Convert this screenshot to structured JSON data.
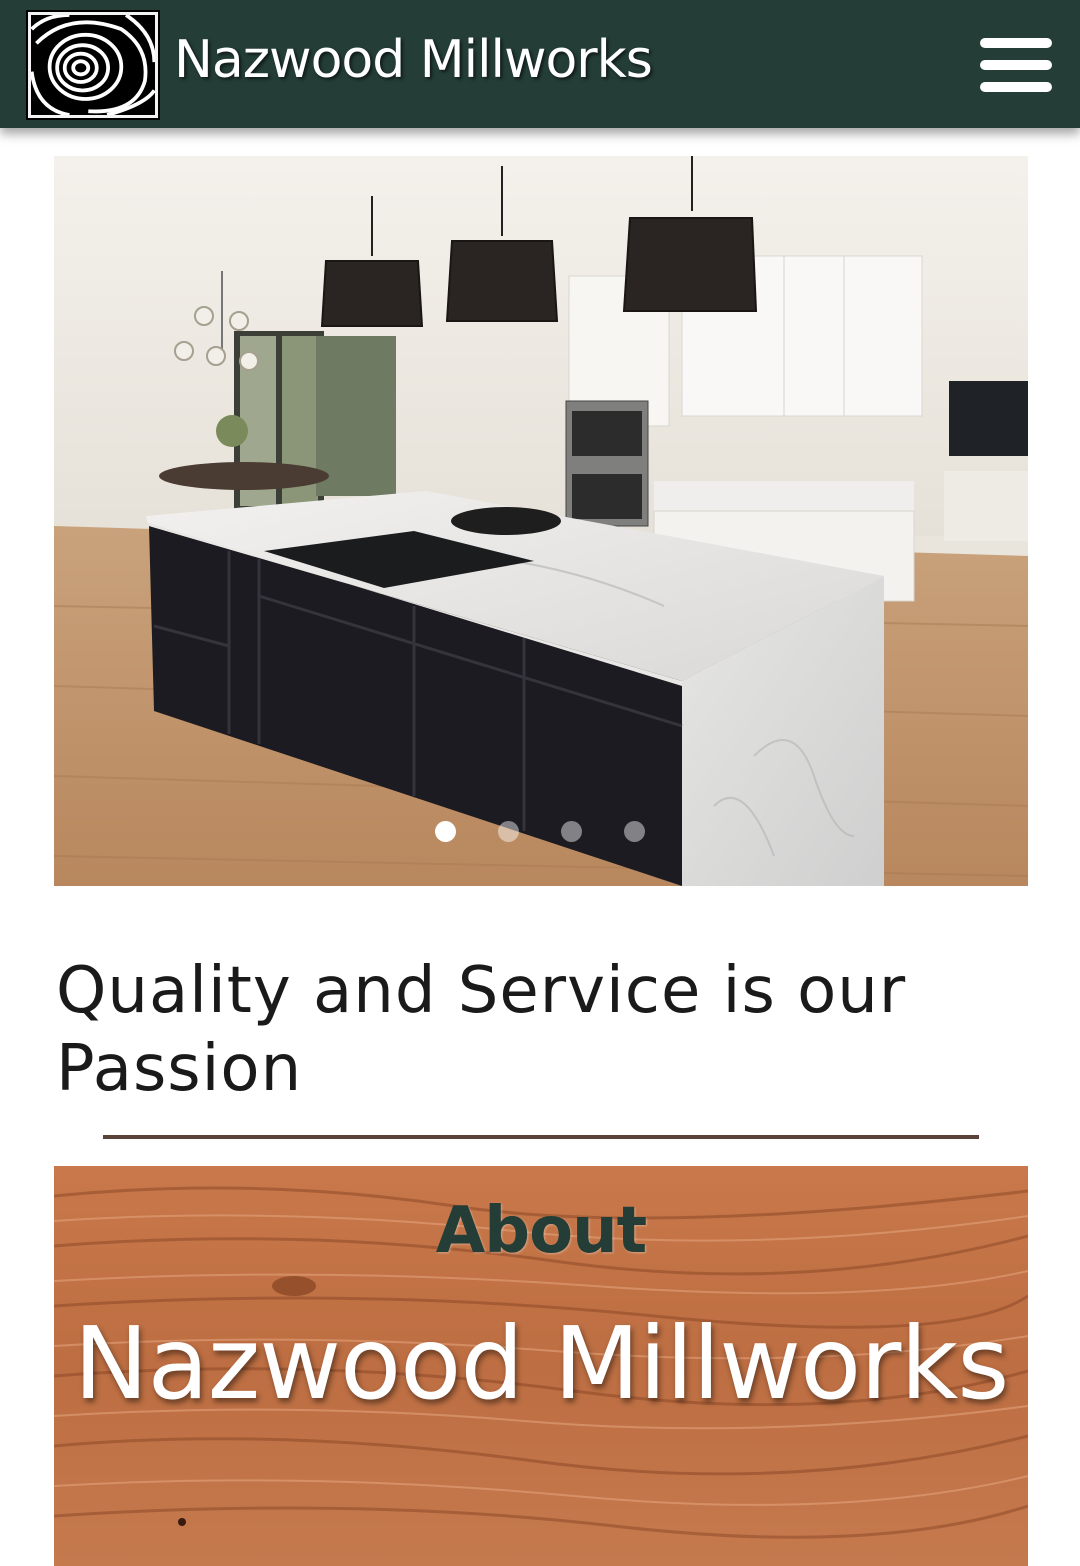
{
  "header": {
    "site_title": "Nazwood Millworks",
    "logo_icon": "wood-grain-logo-icon",
    "menu_icon": "hamburger-menu-icon",
    "background_color": "#243d37"
  },
  "hero": {
    "slide_count": 4,
    "active_slide": 1,
    "image_description_icon": "kitchen-island-photo"
  },
  "tagline": "Quality and Service is our Passion",
  "about": {
    "label": "About",
    "title": "Nazwood Millworks",
    "label_color": "#243d37"
  }
}
